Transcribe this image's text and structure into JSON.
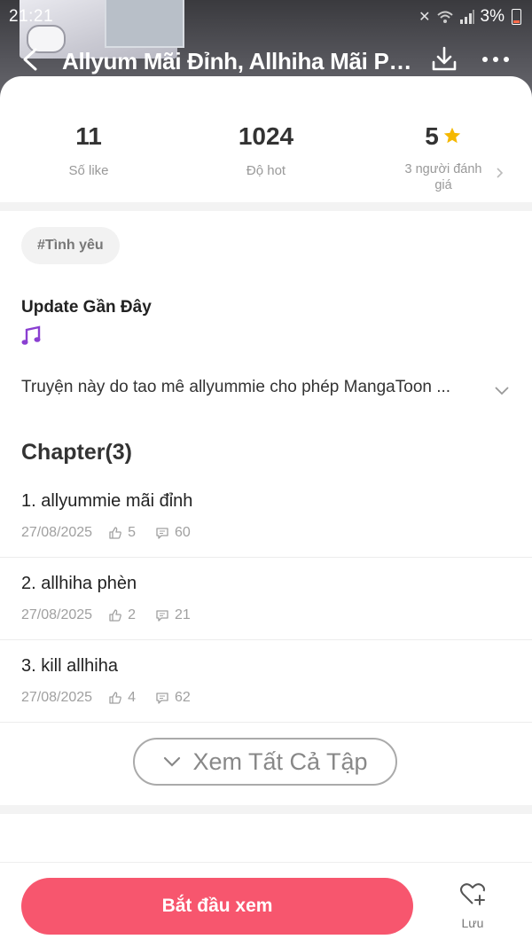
{
  "status_bar": {
    "time": "21:21",
    "battery": "3%"
  },
  "header": {
    "title": "Allyum Mãi Đỉnh, Allhiha Mãi Ph..."
  },
  "stats": {
    "likes": {
      "value": "11",
      "label": "Số like"
    },
    "hot": {
      "value": "1024",
      "label": "Độ hot"
    },
    "rating": {
      "value": "5",
      "label": "3 người đánh giá"
    }
  },
  "tag": "#Tình yêu",
  "update": {
    "title": "Update Gần Đây"
  },
  "description": "Truyện này do tao mê allyummie  cho phép MangaToon ...",
  "chapters": {
    "heading": "Chapter(3)",
    "items": [
      {
        "title": "1. allyummie mãi đỉnh",
        "date": "27/08/2025",
        "likes": "5",
        "comments": "60"
      },
      {
        "title": "2. allhiha phèn",
        "date": "27/08/2025",
        "likes": "2",
        "comments": "21"
      },
      {
        "title": "3. kill allhiha",
        "date": "27/08/2025",
        "likes": "4",
        "comments": "62"
      }
    ]
  },
  "see_all_label": "Xem Tất Cả Tập",
  "bottom": {
    "start_label": "Bắt đầu xem",
    "save_label": "Lưu"
  },
  "colors": {
    "accent": "#f7566e",
    "star": "#f5b800",
    "note": "#8a3fd1"
  },
  "icons": [
    "back-arrow-icon",
    "download-icon",
    "more-icon",
    "star-icon",
    "music-note-icon",
    "chevron-right-icon",
    "chevron-down-icon",
    "thumb-up-icon",
    "comment-icon",
    "heart-plus-icon"
  ]
}
